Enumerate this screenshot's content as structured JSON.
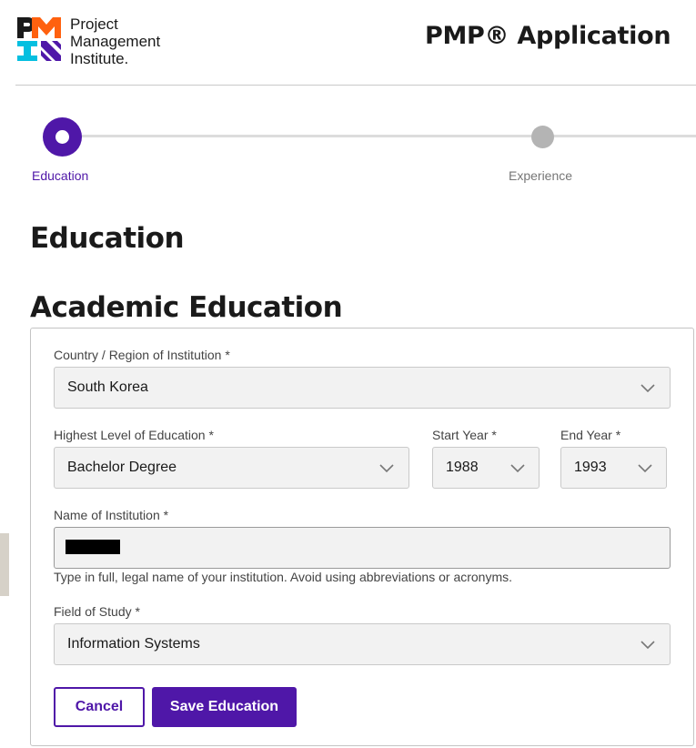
{
  "header": {
    "logo_lines": [
      "Project",
      "Management",
      "Institute."
    ],
    "app_title": "PMP® Application"
  },
  "stepper": {
    "steps": [
      {
        "label": "Education",
        "state": "active"
      },
      {
        "label": "Experience",
        "state": "upcoming"
      }
    ]
  },
  "page": {
    "section_title": "Education",
    "subsection_title": "Academic Education"
  },
  "form": {
    "country": {
      "label": "Country / Region of Institution *",
      "value": "South Korea"
    },
    "education_level": {
      "label": "Highest Level of Education *",
      "value": "Bachelor Degree"
    },
    "start_year": {
      "label": "Start Year *",
      "value": "1988"
    },
    "end_year": {
      "label": "End Year *",
      "value": "1993"
    },
    "institution": {
      "label": "Name of Institution *",
      "helper": "Type in full, legal name of your institution. Avoid using abbreviations or acronyms."
    },
    "field_of_study": {
      "label": "Field of Study *",
      "value": "Information Systems"
    },
    "cancel_label": "Cancel",
    "save_label": "Save Education"
  },
  "colors": {
    "brand_purple": "#4f17a8",
    "logo_orange": "#ff610f",
    "logo_teal": "#05bfe0",
    "inactive_step": "#b4b4b4"
  }
}
